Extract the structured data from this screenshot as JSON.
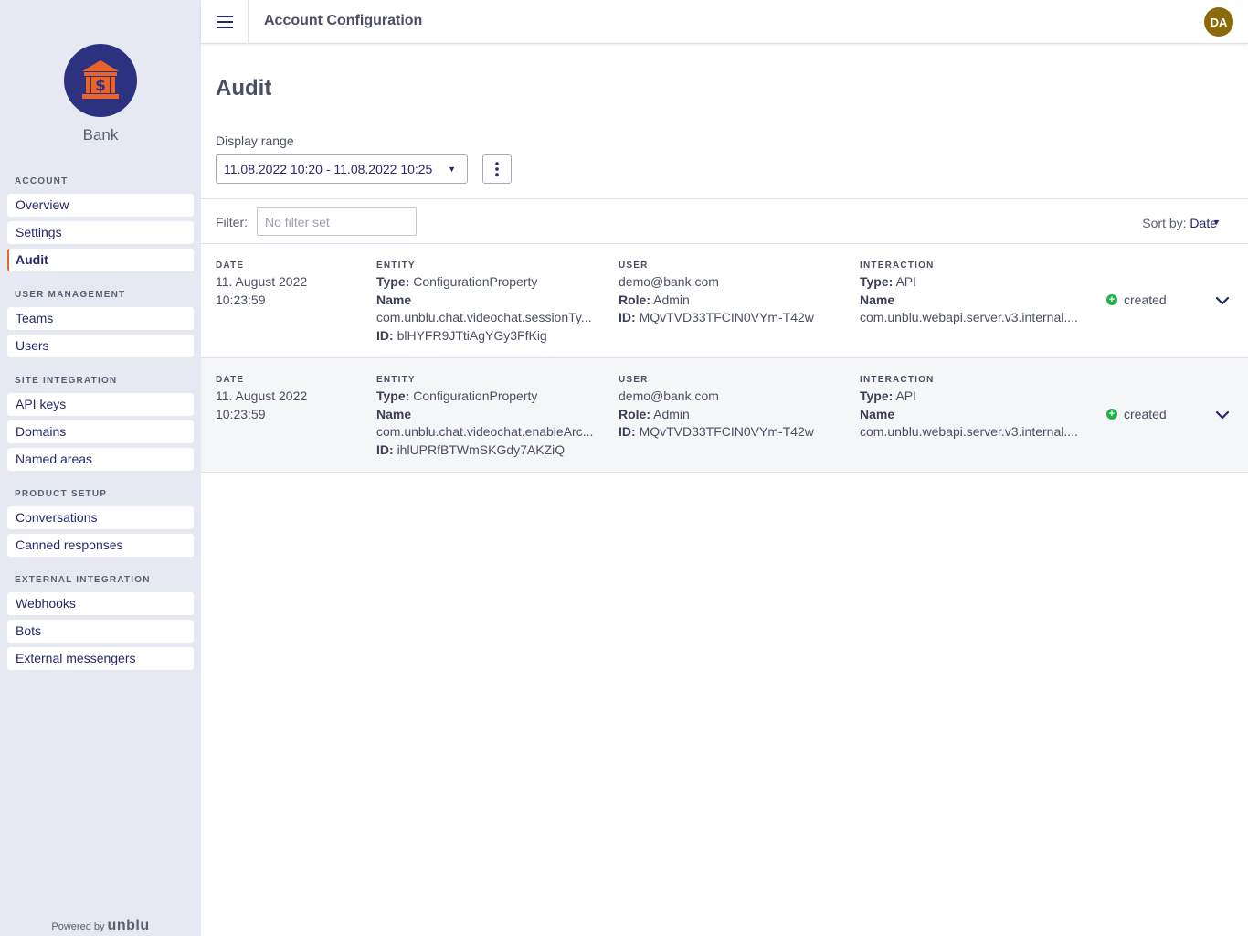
{
  "org": {
    "name": "Bank"
  },
  "header": {
    "title": "Account Configuration",
    "avatar_initials": "DA"
  },
  "nav": {
    "sections": [
      {
        "heading": "ACCOUNT",
        "items": [
          "Overview",
          "Settings",
          "Audit"
        ]
      },
      {
        "heading": "USER MANAGEMENT",
        "items": [
          "Teams",
          "Users"
        ]
      },
      {
        "heading": "SITE INTEGRATION",
        "items": [
          "API keys",
          "Domains",
          "Named areas"
        ]
      },
      {
        "heading": "PRODUCT SETUP",
        "items": [
          "Conversations",
          "Canned responses"
        ]
      },
      {
        "heading": "EXTERNAL INTEGRATION",
        "items": [
          "Webhooks",
          "Bots",
          "External messengers"
        ]
      }
    ],
    "active": "Audit"
  },
  "footer": {
    "powered_by": "Powered by",
    "brand": "unblu"
  },
  "page": {
    "title": "Audit",
    "range_label": "Display range",
    "range_value": "11.08.2022 10:20 - 11.08.2022 10:25"
  },
  "filter": {
    "label": "Filter:",
    "placeholder": "No filter set",
    "value": ""
  },
  "sort": {
    "label": "Sort by:",
    "value": "Date"
  },
  "columns": {
    "date": "DATE",
    "entity": "ENTITY",
    "user": "USER",
    "interaction": "INTERACTION"
  },
  "field_labels": {
    "type": "Type:",
    "name": "Name",
    "id": "ID:",
    "role": "Role:"
  },
  "rows": [
    {
      "date": "11. August 2022",
      "time": "10:23:59",
      "entity_type": "ConfigurationProperty",
      "entity_name": "com.unblu.chat.videochat.sessionTy...",
      "entity_id": "blHYFR9JTtiAgYGy3FfKig",
      "user_email": "demo@bank.com",
      "user_role": "Admin",
      "user_id": "MQvTVD33TFCIN0VYm-T42w",
      "interaction_type": "API",
      "interaction_name": "com.unblu.webapi.server.v3.internal....",
      "status": "created"
    },
    {
      "date": "11. August 2022",
      "time": "10:23:59",
      "entity_type": "ConfigurationProperty",
      "entity_name": "com.unblu.chat.videochat.enableArc...",
      "entity_id": "ihlUPRfBTWmSKGdy7AKZiQ",
      "user_email": "demo@bank.com",
      "user_role": "Admin",
      "user_id": "MQvTVD33TFCIN0VYm-T42w",
      "interaction_type": "API",
      "interaction_name": "com.unblu.webapi.server.v3.internal....",
      "status": "created"
    }
  ],
  "colors": {
    "sidebar_bg": "#e6e9f2",
    "logo_bg": "#2d3280",
    "logo_icon": "#e8642a",
    "active_marker": "#e06a2c",
    "avatar_bg": "#8a6a0a",
    "status_green": "#22b04a",
    "link_navy": "#242a6b"
  },
  "icons": [
    "bank-icon",
    "hamburger-menu-icon",
    "more-vertical-icon",
    "caret-down-icon",
    "plus-circle-icon",
    "chevron-down-icon"
  ]
}
